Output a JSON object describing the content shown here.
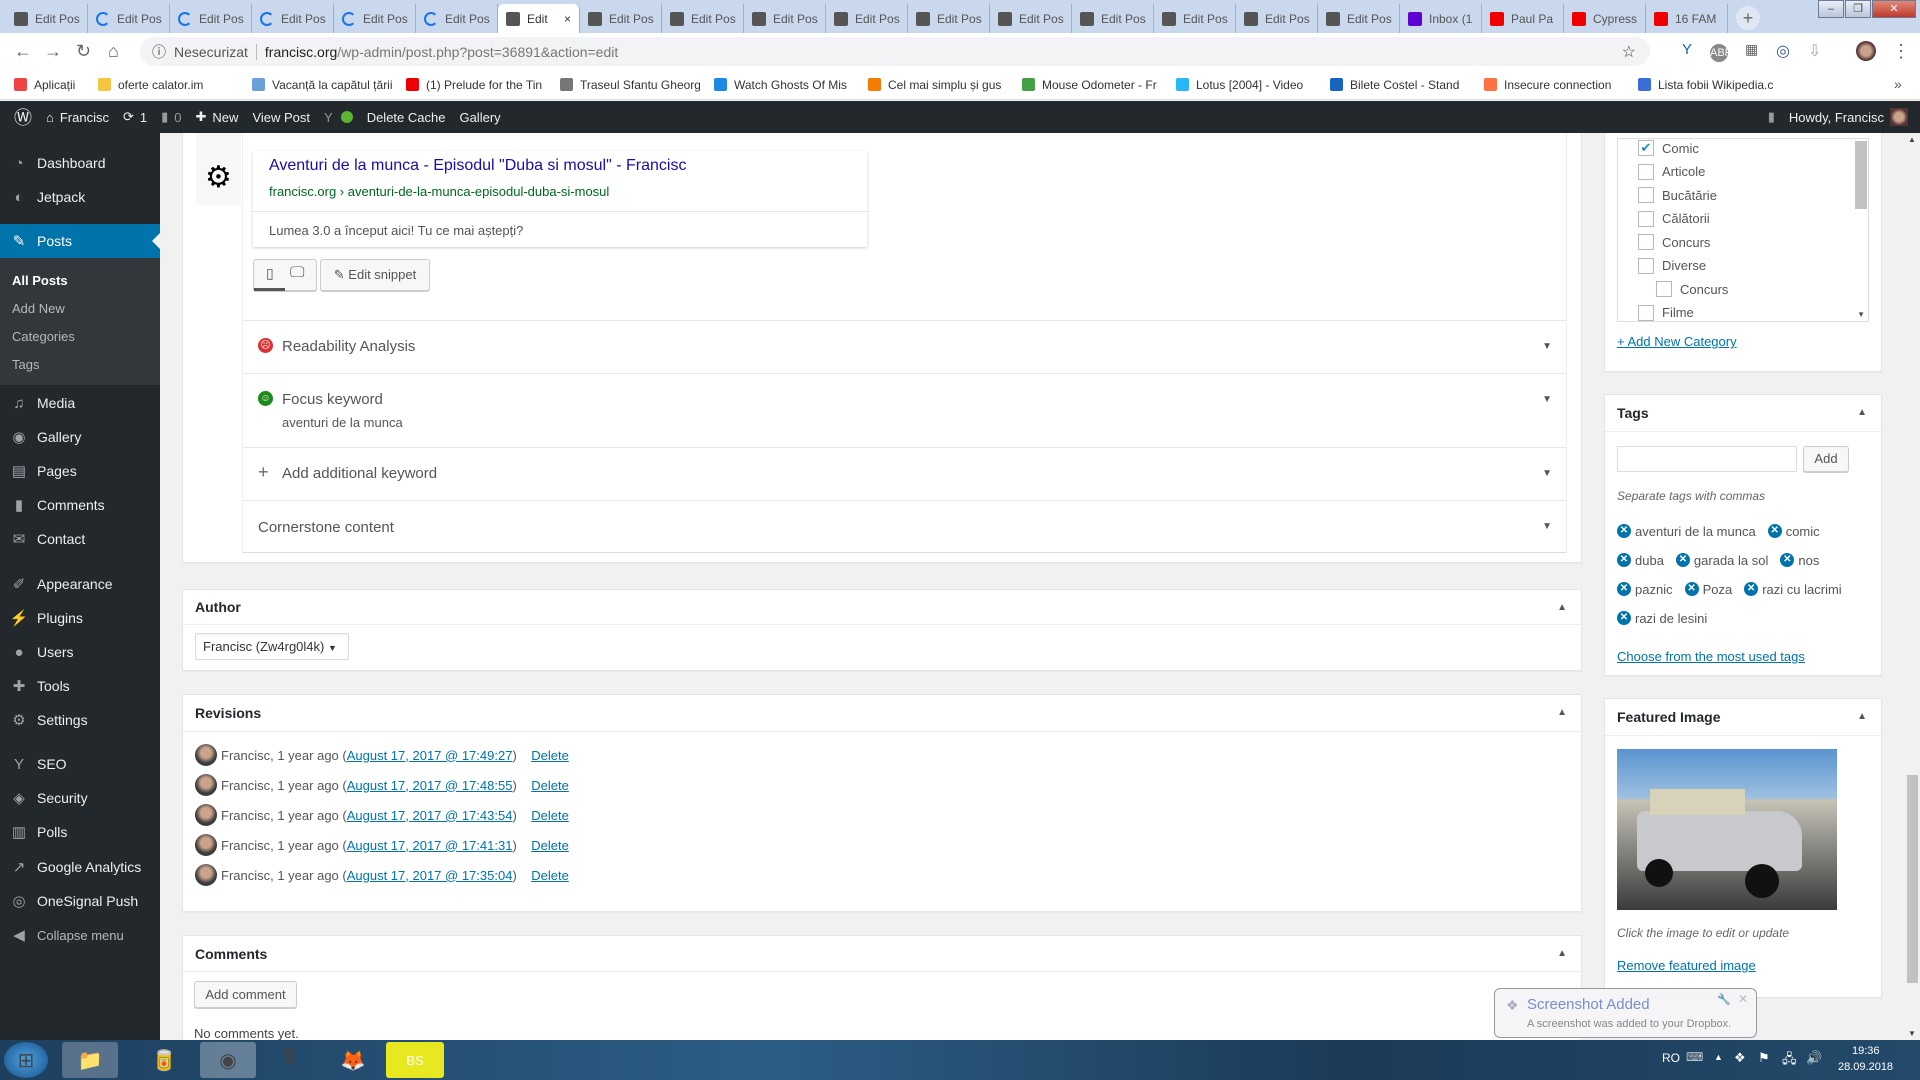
{
  "browser": {
    "tabs": [
      {
        "label": "Edit Pos",
        "icon": "avatar-favicon"
      },
      {
        "label": "Edit Pos",
        "icon": "loading-icon"
      },
      {
        "label": "Edit Pos",
        "icon": "loading-icon"
      },
      {
        "label": "Edit Pos",
        "icon": "loading-icon"
      },
      {
        "label": "Edit Pos",
        "icon": "loading-icon"
      },
      {
        "label": "Edit Pos",
        "icon": "loading-icon"
      },
      {
        "label": "Edit",
        "icon": "avatar-favicon",
        "active": true
      },
      {
        "label": "Edit Pos",
        "icon": "avatar-favicon"
      },
      {
        "label": "Edit Pos",
        "icon": "avatar-favicon"
      },
      {
        "label": "Edit Pos",
        "icon": "avatar-favicon"
      },
      {
        "label": "Edit Pos",
        "icon": "avatar-favicon"
      },
      {
        "label": "Edit Pos",
        "icon": "avatar-favicon"
      },
      {
        "label": "Edit Pos",
        "icon": "avatar-favicon"
      },
      {
        "label": "Edit Pos",
        "icon": "avatar-favicon"
      },
      {
        "label": "Edit Pos",
        "icon": "avatar-favicon"
      },
      {
        "label": "Edit Pos",
        "icon": "avatar-favicon"
      },
      {
        "label": "Edit Pos",
        "icon": "avatar-favicon"
      },
      {
        "label": "Inbox (1",
        "icon": "yahoo-icon"
      },
      {
        "label": "Paul Pa",
        "icon": "youtube-icon"
      },
      {
        "label": "Cypress",
        "icon": "youtube-icon"
      },
      {
        "label": "16 FAM",
        "icon": "youtube-icon"
      }
    ],
    "security_label": "Nesecurizat",
    "url_host": "francisc.org",
    "url_path": "/wp-admin/post.php?post=36891&action=edit",
    "bookmarks": [
      {
        "label": "Aplicații",
        "color": "#e44"
      },
      {
        "label": "oferte calator.im",
        "color": "#f4c542"
      },
      {
        "label": "Vacanță la capătul țării",
        "color": "#6a9fd8"
      },
      {
        "label": "(1) Prelude for the Tin",
        "color": "#e00"
      },
      {
        "label": "Traseul Sfantu Gheorgus",
        "color": "#777"
      },
      {
        "label": "Watch Ghosts Of Mis",
        "color": "#1e88e5"
      },
      {
        "label": "Cel mai simplu și gus",
        "color": "#f57c00"
      },
      {
        "label": "Mouse Odometer - Fr",
        "color": "#43a047"
      },
      {
        "label": "Lotus [2004] - Video",
        "color": "#29b6f6"
      },
      {
        "label": "Bilete Costel - Stand",
        "color": "#1565c0"
      },
      {
        "label": "Insecure connection",
        "color": "#ff7043"
      },
      {
        "label": "Lista fobii Wikipedia.c",
        "color": "#3b6fd8"
      }
    ]
  },
  "adminbar": {
    "site": "Francisc",
    "updates": "1",
    "comments": "0",
    "new": "New",
    "view_post": "View Post",
    "delete_cache": "Delete Cache",
    "gallery": "Gallery",
    "howdy": "Howdy, Francisc"
  },
  "sidebar": {
    "items": [
      {
        "label": "Dashboard",
        "icon": "dashboard-icon",
        "glyph": "◔"
      },
      {
        "label": "Jetpack",
        "icon": "jetpack-icon",
        "glyph": "◐"
      },
      {
        "label": "Posts",
        "icon": "pin-icon",
        "glyph": "✎",
        "current": true
      },
      {
        "label": "Media",
        "icon": "media-icon",
        "glyph": "♫"
      },
      {
        "label": "Gallery",
        "icon": "gallery-icon",
        "glyph": "◉"
      },
      {
        "label": "Pages",
        "icon": "pages-icon",
        "glyph": "▤"
      },
      {
        "label": "Comments",
        "icon": "comments-icon",
        "glyph": "▮"
      },
      {
        "label": "Contact",
        "icon": "mail-icon",
        "glyph": "✉"
      },
      {
        "label": "Appearance",
        "icon": "brush-icon",
        "glyph": "✐"
      },
      {
        "label": "Plugins",
        "icon": "plugin-icon",
        "glyph": "⚡"
      },
      {
        "label": "Users",
        "icon": "users-icon",
        "glyph": "●"
      },
      {
        "label": "Tools",
        "icon": "wrench-icon",
        "glyph": "✚"
      },
      {
        "label": "Settings",
        "icon": "settings-icon",
        "glyph": "⚙"
      },
      {
        "label": "SEO",
        "icon": "yoast-icon",
        "glyph": "Y"
      },
      {
        "label": "Security",
        "icon": "shield-icon",
        "glyph": "◈"
      },
      {
        "label": "Polls",
        "icon": "bar-chart-icon",
        "glyph": "▥"
      },
      {
        "label": "Google Analytics",
        "icon": "analytics-icon",
        "glyph": "↗"
      },
      {
        "label": "OneSignal Push",
        "icon": "onesignal-icon",
        "glyph": "◎"
      },
      {
        "label": "Collapse menu",
        "icon": "collapse-icon",
        "glyph": "◀"
      }
    ],
    "submenu": [
      {
        "label": "All Posts",
        "current": true
      },
      {
        "label": "Add New"
      },
      {
        "label": "Categories"
      },
      {
        "label": "Tags"
      }
    ]
  },
  "snippet": {
    "title": "Aventuri de la munca - Episodul \"Duba si mosul\" - Francisc",
    "url": "francisc.org › aventuri-de-la-munca-episodul-duba-si-mosul",
    "description": "Lumea 3.0 a început aici! Tu ce mai aștepți?",
    "edit_label": "Edit snippet"
  },
  "yoast": {
    "readability": "Readability Analysis",
    "focus": "Focus keyword",
    "focus_value": "aventuri de la munca",
    "additional": "Add additional keyword",
    "cornerstone": "Cornerstone content"
  },
  "author": {
    "title": "Author",
    "selected": "Francisc (Zw4rg0l4k)"
  },
  "revisions": {
    "title": "Revisions",
    "rows": [
      {
        "who": "Francisc, 1 year ago ",
        "date": "August 17, 2017 @ 17:49:27",
        "delete": "Delete"
      },
      {
        "who": "Francisc, 1 year ago ",
        "date": "August 17, 2017 @ 17:48:55",
        "delete": "Delete"
      },
      {
        "who": "Francisc, 1 year ago ",
        "date": "August 17, 2017 @ 17:43:54",
        "delete": "Delete"
      },
      {
        "who": "Francisc, 1 year ago ",
        "date": "August 17, 2017 @ 17:41:31",
        "delete": "Delete"
      },
      {
        "who": "Francisc, 1 year ago ",
        "date": "August 17, 2017 @ 17:35:04",
        "delete": "Delete"
      }
    ]
  },
  "comments": {
    "title": "Comments",
    "add": "Add comment",
    "empty": "No comments yet."
  },
  "categories": {
    "items": [
      {
        "label": "Comic",
        "checked": true
      },
      {
        "label": "Articole"
      },
      {
        "label": "Bucătărie"
      },
      {
        "label": "Călătorii"
      },
      {
        "label": "Concurs"
      },
      {
        "label": "Diverse"
      },
      {
        "label": "Concurs",
        "child": true
      },
      {
        "label": "Filme"
      }
    ],
    "add_new": "+ Add New Category"
  },
  "tags": {
    "title": "Tags",
    "input_value": "",
    "add": "Add",
    "hint": "Separate tags with commas",
    "rows": [
      [
        "aventuri de la munca",
        "comic"
      ],
      [
        "duba",
        "garada la sol",
        "nos"
      ],
      [
        "paznic",
        "Poza",
        "razi cu lacrimi"
      ],
      [
        "razi de lesini"
      ]
    ],
    "most_used": "Choose from the most used tags"
  },
  "featured": {
    "title": "Featured Image",
    "caption": "Click the image to edit or update",
    "remove": "Remove featured image"
  },
  "toast": {
    "title": "Screenshot Added",
    "body": "A screenshot was added to your Dropbox."
  },
  "tray": {
    "lang": "RO",
    "time": "19:36",
    "date": "28.09.2018"
  }
}
